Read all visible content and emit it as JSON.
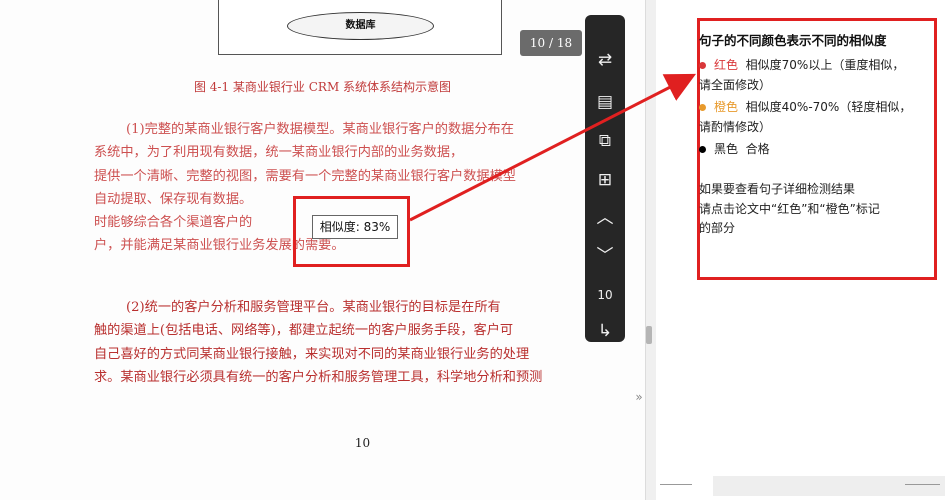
{
  "figure": {
    "db_label": "数据库",
    "caption": "图 4-1 某商业银行业 CRM 系统体系结构示意图"
  },
  "page_indicator": "10 / 18",
  "paragraph1": [
    "(1)完整的某商业银行客户数据模型。某商业银行客户的数据分布在",
    "系统中，为了利用现有数据，统一某商业银行内部的业务数据，",
    "提供一个清晰、完整的视图，需要有一个完整的某商业银行客户数据模型",
    "自动提取、保存现有数据。",
    "时能够综合各个渠道客户的",
    "户，并能满足某商业银行业务发展的需要。"
  ],
  "paragraph2": [
    "(2)统一的客户分析和服务管理平台。某商业银行的目标是在所有",
    "触的渠道上(包括电话、网络等)，都建立起统一的客户服务手段，客户可",
    "自己喜好的方式同某商业银行接触，来实现对不同的某商业银行业务的处理",
    "求。某商业银行必须具有统一的客户分析和服务管理工具，科学地分析和预测"
  ],
  "similarity_tooltip": "相似度: 83%",
  "page_number": "10",
  "toolbar": {
    "items": [
      {
        "icon": "⇄"
      },
      {
        "icon": "▤"
      },
      {
        "icon": "⧉"
      },
      {
        "icon": "⊞"
      },
      {
        "icon": "︿"
      },
      {
        "icon": "﹀"
      },
      {
        "icon": "↳"
      }
    ],
    "page_value": "10"
  },
  "legend": {
    "title": "句子的不同颜色表示不同的相似度",
    "red": {
      "color": "#d9383a",
      "name": "红色",
      "desc": "相似度70%以上（重度相似，",
      "desc2": "请全面修改）"
    },
    "orange": {
      "color": "#e89a2c",
      "name": "橙色",
      "desc": "相似度40%-70%（轻度相似，",
      "desc2": "请酌情修改）"
    },
    "black": {
      "color": "#000000",
      "name": "黑色",
      "desc": "合格"
    },
    "note_line1": "如果要查看句子详细检测结果",
    "note_line2": "请点击论文中“红色”和“橙色”标记",
    "note_line3": "的部分"
  },
  "colors": {
    "annotation_red": "#e02020",
    "toolbar_bg": "#262626"
  }
}
